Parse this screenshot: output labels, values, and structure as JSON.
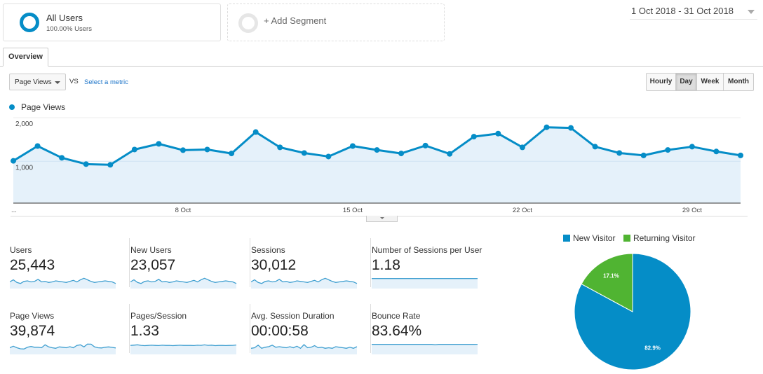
{
  "segments": {
    "all_users": {
      "title": "All Users",
      "subtitle": "100.00% Users"
    },
    "add_segment": {
      "label": "+ Add Segment"
    }
  },
  "date_range": "1 Oct 2018 - 31 Oct 2018",
  "tabs": [
    {
      "label": "Overview",
      "active": true
    }
  ],
  "controls": {
    "metric_select": "Page Views",
    "vs_label": "VS",
    "select_metric_link": "Select a metric",
    "granularity": [
      {
        "label": "Hourly",
        "active": false
      },
      {
        "label": "Day",
        "active": true
      },
      {
        "label": "Week",
        "active": false
      },
      {
        "label": "Month",
        "active": false
      }
    ]
  },
  "colors": {
    "primary": "#058dc7",
    "area_fill": "#e5f1fa",
    "new_visitor": "#058dc7",
    "returning_visitor": "#50b432"
  },
  "chart_data": [
    {
      "type": "area",
      "title": "",
      "legend": [
        {
          "name": "Page Views",
          "color": "#058dc7"
        }
      ],
      "legend_placement": "top-left",
      "x": [
        "1 Oct",
        "2 Oct",
        "3 Oct",
        "4 Oct",
        "5 Oct",
        "6 Oct",
        "7 Oct",
        "8 Oct",
        "9 Oct",
        "10 Oct",
        "11 Oct",
        "12 Oct",
        "13 Oct",
        "14 Oct",
        "15 Oct",
        "16 Oct",
        "17 Oct",
        "18 Oct",
        "19 Oct",
        "20 Oct",
        "21 Oct",
        "22 Oct",
        "23 Oct",
        "24 Oct",
        "25 Oct",
        "26 Oct",
        "27 Oct",
        "28 Oct",
        "29 Oct",
        "30 Oct",
        "31 Oct"
      ],
      "series": [
        {
          "name": "Page Views",
          "values": [
            1010,
            1350,
            1080,
            935,
            920,
            1270,
            1400,
            1255,
            1270,
            1180,
            1670,
            1320,
            1190,
            1110,
            1350,
            1260,
            1180,
            1360,
            1170,
            1565,
            1635,
            1320,
            1780,
            1765,
            1335,
            1190,
            1135,
            1260,
            1335,
            1225,
            1135
          ]
        }
      ],
      "x_tick_labels": [
        {
          "index": 0,
          "label": "..."
        },
        {
          "index": 7,
          "label": "8 Oct"
        },
        {
          "index": 14,
          "label": "15 Oct"
        },
        {
          "index": 21,
          "label": "22 Oct"
        },
        {
          "index": 28,
          "label": "29 Oct"
        }
      ],
      "y_tick_labels": [
        {
          "value": 2000,
          "label": "2,000"
        },
        {
          "value": 1000,
          "label": "1,000"
        }
      ],
      "ylim": [
        0,
        2000
      ],
      "grid": true
    },
    {
      "type": "pie",
      "legend": [
        "New Visitor",
        "Returning Visitor"
      ],
      "legend_placement": "top",
      "slices": [
        {
          "label": "New Visitor",
          "value": 82.9,
          "display": "82.9%",
          "color": "#058dc7"
        },
        {
          "label": "Returning Visitor",
          "value": 17.1,
          "display": "17.1%",
          "color": "#50b432"
        }
      ]
    }
  ],
  "metrics": [
    {
      "label": "Users",
      "value": "25,443",
      "trend": [
        0.5,
        0.7,
        0.45,
        0.35,
        0.55,
        0.6,
        0.5,
        0.55,
        0.75,
        0.5,
        0.55,
        0.45,
        0.5,
        0.6,
        0.55,
        0.5,
        0.45,
        0.55,
        0.65,
        0.5,
        0.7,
        0.85,
        0.7,
        0.55,
        0.45,
        0.5,
        0.55,
        0.6,
        0.55,
        0.5,
        0.35
      ]
    },
    {
      "label": "New Users",
      "value": "23,057",
      "trend": [
        0.5,
        0.7,
        0.45,
        0.35,
        0.55,
        0.6,
        0.5,
        0.55,
        0.75,
        0.5,
        0.55,
        0.45,
        0.5,
        0.6,
        0.55,
        0.5,
        0.45,
        0.55,
        0.65,
        0.5,
        0.7,
        0.85,
        0.7,
        0.55,
        0.45,
        0.5,
        0.55,
        0.6,
        0.55,
        0.5,
        0.35
      ]
    },
    {
      "label": "Sessions",
      "value": "30,012",
      "trend": [
        0.5,
        0.7,
        0.45,
        0.35,
        0.55,
        0.6,
        0.5,
        0.55,
        0.75,
        0.5,
        0.55,
        0.45,
        0.5,
        0.6,
        0.55,
        0.5,
        0.45,
        0.55,
        0.65,
        0.5,
        0.7,
        0.85,
        0.7,
        0.55,
        0.45,
        0.5,
        0.55,
        0.6,
        0.55,
        0.5,
        0.35
      ]
    },
    {
      "label": "Number of Sessions per User",
      "value": "1.18",
      "trend": [
        0.82,
        0.82,
        0.83,
        0.82,
        0.82,
        0.83,
        0.82,
        0.82,
        0.82,
        0.83,
        0.82,
        0.82,
        0.82,
        0.82,
        0.83,
        0.82,
        0.82,
        0.82,
        0.82,
        0.83,
        0.82,
        0.82,
        0.82,
        0.82,
        0.83,
        0.82,
        0.82,
        0.82,
        0.82,
        0.82,
        0.82
      ]
    },
    {
      "label": "Page Views",
      "value": "39,874",
      "trend": [
        0.5,
        0.65,
        0.5,
        0.4,
        0.38,
        0.55,
        0.62,
        0.55,
        0.55,
        0.5,
        0.78,
        0.58,
        0.5,
        0.45,
        0.58,
        0.55,
        0.5,
        0.6,
        0.5,
        0.72,
        0.78,
        0.58,
        0.85,
        0.84,
        0.58,
        0.5,
        0.48,
        0.55,
        0.58,
        0.53,
        0.48
      ]
    },
    {
      "label": "Pages/Session",
      "value": "1.33",
      "trend": [
        0.72,
        0.75,
        0.78,
        0.73,
        0.7,
        0.72,
        0.74,
        0.72,
        0.71,
        0.74,
        0.72,
        0.73,
        0.7,
        0.72,
        0.74,
        0.72,
        0.73,
        0.72,
        0.71,
        0.74,
        0.73,
        0.77,
        0.73,
        0.75,
        0.7,
        0.72,
        0.72,
        0.71,
        0.72,
        0.73,
        0.76
      ]
    },
    {
      "label": "Avg. Session Duration",
      "value": "00:00:58",
      "trend": [
        0.45,
        0.5,
        0.75,
        0.45,
        0.55,
        0.6,
        0.75,
        0.55,
        0.6,
        0.55,
        0.5,
        0.6,
        0.5,
        0.65,
        0.45,
        0.8,
        0.5,
        0.55,
        0.7,
        0.5,
        0.55,
        0.45,
        0.5,
        0.45,
        0.6,
        0.55,
        0.5,
        0.45,
        0.55,
        0.45,
        0.6
      ]
    },
    {
      "label": "Bounce Rate",
      "value": "83.64%",
      "trend": [
        0.82,
        0.82,
        0.82,
        0.83,
        0.82,
        0.82,
        0.82,
        0.82,
        0.82,
        0.82,
        0.83,
        0.82,
        0.82,
        0.82,
        0.82,
        0.82,
        0.82,
        0.82,
        0.78,
        0.82,
        0.82,
        0.82,
        0.82,
        0.82,
        0.82,
        0.83,
        0.82,
        0.82,
        0.82,
        0.82,
        0.83
      ]
    }
  ]
}
